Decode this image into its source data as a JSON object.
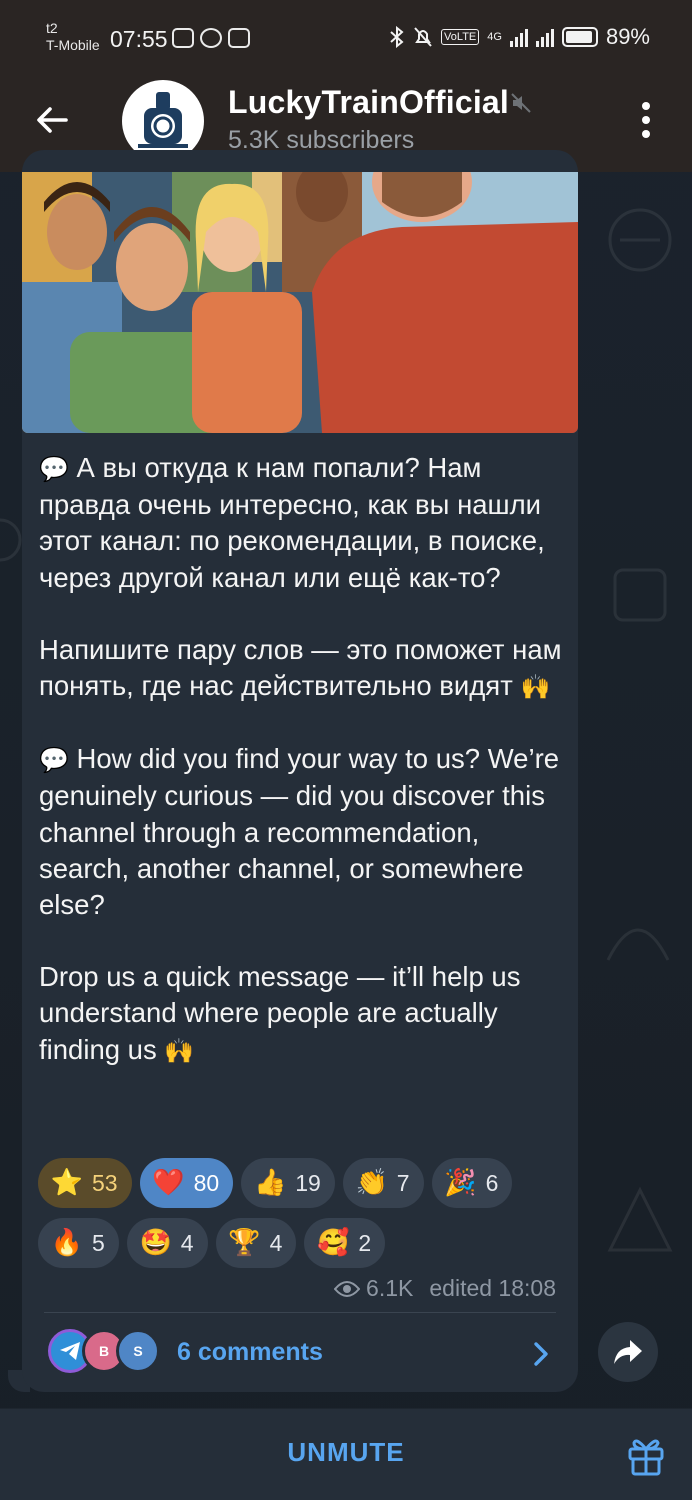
{
  "status_bar": {
    "carrier_top": "t2",
    "carrier_bottom": "T-Mobile",
    "time": "07:55",
    "network": "4G",
    "battery": "89%"
  },
  "header": {
    "title": "LuckyTrainOfficial",
    "subscribers": "5.3K subscribers",
    "icons": [
      "back-arrow-icon",
      "muted-icon",
      "more-vertical-icon"
    ]
  },
  "post": {
    "paragraphs": [
      {
        "emoji": "💬",
        "text": "А вы откуда к нам попали? Нам правда очень интересно, как вы нашли этот канал: по рекомендации, в поиске, через другой канал или ещё как-то?"
      },
      {
        "emoji": "",
        "text": "Напишите пару слов — это поможет нам понять, где нас действительно видят",
        "trailing": "🙌"
      },
      {
        "emoji": "💬",
        "text": "How did you find your way to us? We’re genuinely curious — did you discover this channel through a recommendation, search, another channel, or somewhere else?"
      },
      {
        "emoji": "",
        "text": "Drop us a quick message — it’ll help us understand where people are actually finding us",
        "trailing": "🙌"
      }
    ],
    "reactions_row1": [
      {
        "emoji": "⭐",
        "count": "53",
        "kind": "star"
      },
      {
        "emoji": "❤️",
        "count": "80",
        "kind": "active"
      },
      {
        "emoji": "👍",
        "count": "19",
        "kind": ""
      },
      {
        "emoji": "👏",
        "count": "7",
        "kind": ""
      },
      {
        "emoji": "🎉",
        "count": "6",
        "kind": ""
      }
    ],
    "reactions_row2": [
      {
        "emoji": "🔥",
        "count": "5",
        "kind": ""
      },
      {
        "emoji": "🤩",
        "count": "4",
        "kind": ""
      },
      {
        "emoji": "🏆",
        "count": "4",
        "kind": ""
      },
      {
        "emoji": "🥰",
        "count": "2",
        "kind": ""
      }
    ],
    "views": "6.1K",
    "edited": "edited 18:08",
    "comments_label": "6 comments",
    "commenter_initials": [
      "B",
      "S"
    ]
  },
  "bottom": {
    "action": "UNMUTE"
  },
  "colors": {
    "accent": "#58a5f0",
    "bubble": "#252e39",
    "header": "#2a2523",
    "heart_chip": "#4f86c6"
  }
}
